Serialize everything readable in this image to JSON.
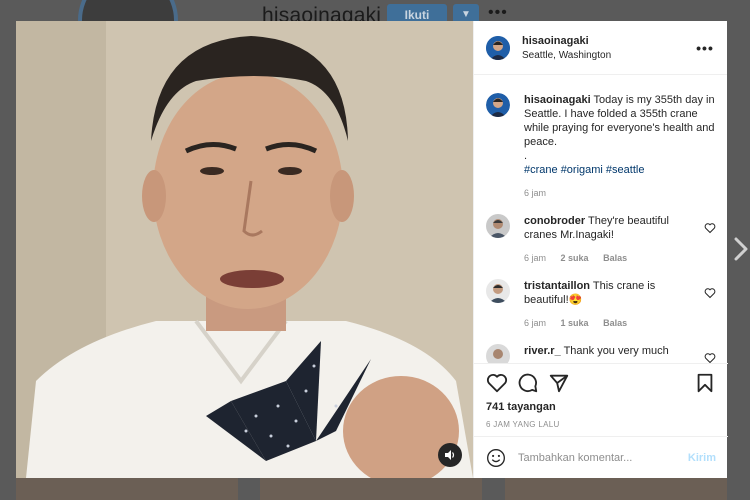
{
  "background": {
    "username": "hisaoinagaki",
    "follow_label": "Ikuti",
    "dropdown_icon": "chevron-down-icon",
    "more_label": "•••"
  },
  "post": {
    "username": "hisaoinagaki",
    "location": "Seattle, Washington",
    "more_label": "•••",
    "caption": {
      "username": "hisaoinagaki",
      "text": "Today is my 355th day in Seattle. I have folded a 355th crane while praying for everyone's health and peace.",
      "dot": ".",
      "hashtags": "#crane #origami #seattle",
      "time": "6 jam"
    },
    "comments": [
      {
        "username": "conobroder",
        "text": "They're beautiful cranes Mr.Inagaki!",
        "time": "6 jam",
        "likes": "2 suka",
        "reply": "Balas"
      },
      {
        "username": "tristantaillon",
        "text": "This crane is beautiful!😍",
        "time": "6 jam",
        "likes": "1 suka",
        "reply": "Balas"
      },
      {
        "username": "river.r_",
        "text": "Thank you very much",
        "time": "",
        "likes": "",
        "reply": ""
      }
    ],
    "views": "741 tayangan",
    "posted_ago": "6 JAM YANG LALU",
    "comment_placeholder": "Tambahkan komentar...",
    "post_label": "Kirim"
  },
  "colors": {
    "link": "#00376b",
    "secondary_text": "#8e8e8e",
    "post_button_disabled": "#b2dffc",
    "follow_button": "#3f6f99"
  }
}
